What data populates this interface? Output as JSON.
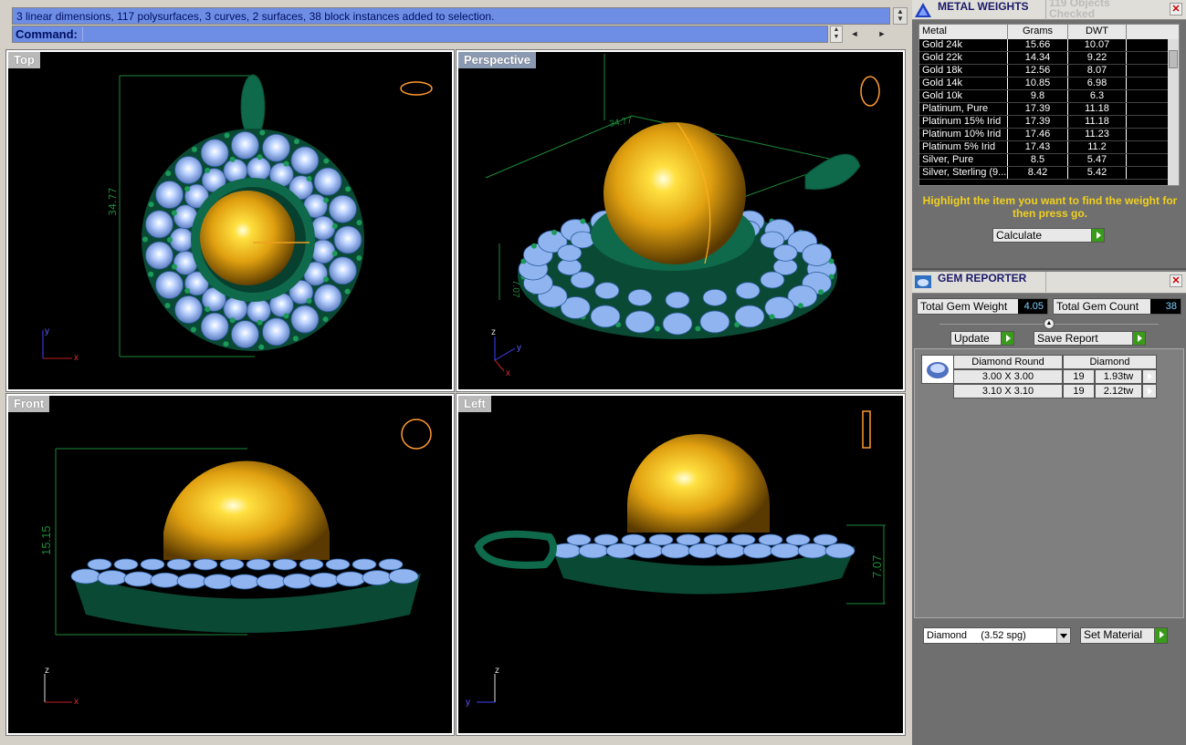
{
  "command": {
    "history_text": "3 linear dimensions, 117 polysurfaces, 3 curves, 2 surfaces, 38 block instances added to selection.",
    "prompt_label": "Command:",
    "input_value": ""
  },
  "viewports": {
    "top": {
      "label": "Top",
      "dimension": "34.77",
      "axis_x": "x",
      "axis_y": "y"
    },
    "perspective": {
      "label": "Perspective",
      "dimension_1": "34.77",
      "dimension_2": "7.07",
      "axis_x": "x",
      "axis_y": "y",
      "axis_z": "z"
    },
    "front": {
      "label": "Front",
      "dimension": "15.15",
      "axis_x": "x",
      "axis_z": "z"
    },
    "left": {
      "label": "Left",
      "dimension": "7.07",
      "axis_y": "y",
      "axis_z": "z"
    }
  },
  "metal_weights": {
    "title": "METAL WEIGHTS",
    "subtitle": "119 Objects Checked",
    "columns": [
      "Metal",
      "Grams",
      "DWT"
    ],
    "rows": [
      [
        "Gold 24k",
        "15.66",
        "10.07"
      ],
      [
        "Gold 22k",
        "14.34",
        "9.22"
      ],
      [
        "Gold 18k",
        "12.56",
        "8.07"
      ],
      [
        "Gold 14k",
        "10.85",
        "6.98"
      ],
      [
        "Gold 10k",
        "9.8",
        "6.3"
      ],
      [
        "Platinum, Pure",
        "17.39",
        "11.18"
      ],
      [
        "Platinum 15% Irid",
        "17.39",
        "11.18"
      ],
      [
        "Platinum 10% Irid",
        "17.46",
        "11.23"
      ],
      [
        "Platinum 5% Irid",
        "17.43",
        "11.2"
      ],
      [
        "Silver, Pure",
        "8.5",
        "5.47"
      ],
      [
        "Silver, Sterling (9...",
        "8.42",
        "5.42"
      ]
    ],
    "hint": "Highlight the item you want to find the weight for then press go.",
    "calculate_label": "Calculate"
  },
  "gem_reporter": {
    "title": "GEM REPORTER",
    "total_weight_label": "Total Gem Weight",
    "total_weight_value": "4.05",
    "total_count_label": "Total Gem Count",
    "total_count_value": "38",
    "update_label": "Update",
    "save_label": "Save Report",
    "table": {
      "headers": [
        "Diamond Round",
        "Diamond"
      ],
      "rows": [
        [
          "3.00 X 3.00",
          "19",
          "1.93tw"
        ],
        [
          "3.10 X 3.10",
          "19",
          "2.12tw"
        ]
      ]
    },
    "material_select": "Diamond     (3.52 spg)",
    "set_material_label": "Set Material"
  },
  "colors": {
    "command_bg": "#6e8ee6",
    "gold": "#e0a010",
    "setting_green": "#0e6a4a",
    "gem_blue": "#8fb4f0",
    "hint_yellow": "#f0d020"
  }
}
